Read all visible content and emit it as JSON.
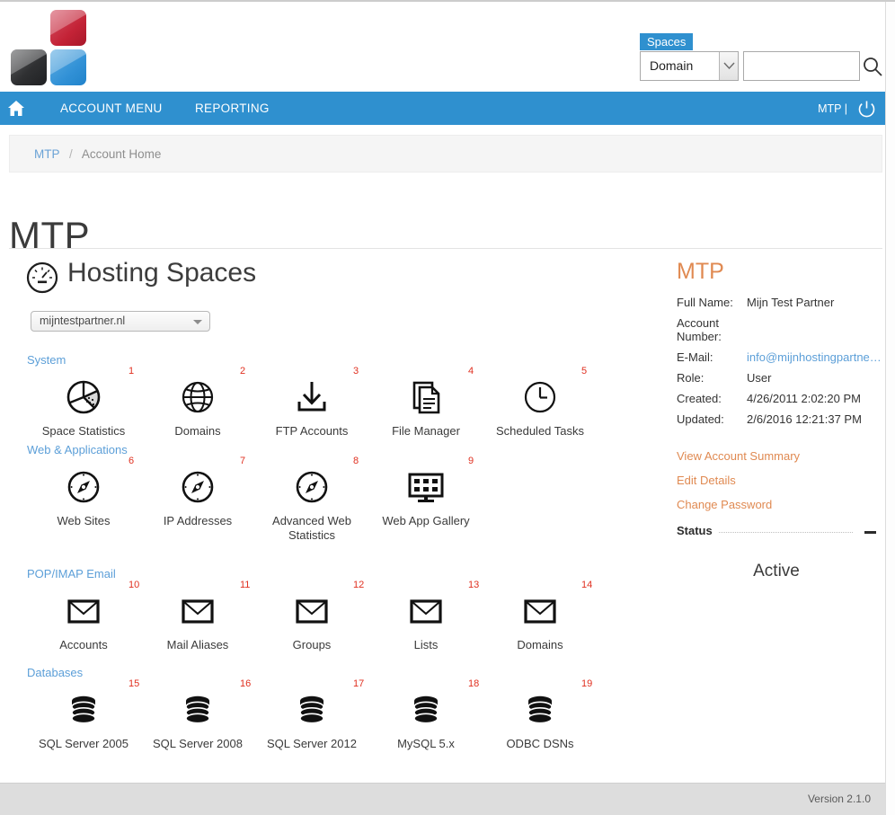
{
  "brand": {
    "logo_name": "mijn-hosting-partner-logo",
    "colors": {
      "accent_blue": "#2f90cf",
      "accent_orange": "#e08a52",
      "badge_red": "#e03020",
      "link_blue": "#5c9fd8"
    }
  },
  "search": {
    "tab_label": "Spaces",
    "scope_value": "Domain",
    "query_value": "",
    "query_placeholder": ""
  },
  "nav": {
    "home_label": "Home",
    "account_menu": "ACCOUNT MENU",
    "reporting": "REPORTING",
    "user": "MTP |",
    "logout_label": "Log off"
  },
  "breadcrumb": {
    "root": "MTP",
    "separator": "/",
    "current": "Account Home"
  },
  "page": {
    "title": "MTP"
  },
  "hosting": {
    "section_title": "Hosting Spaces",
    "space_selected": "mijntestpartner.nl",
    "groups": [
      {
        "label": "System",
        "tiles": [
          {
            "badge": "1",
            "label": "Space Statistics",
            "icon": "pie-chart-icon"
          },
          {
            "badge": "2",
            "label": "Domains",
            "icon": "globe-icon"
          },
          {
            "badge": "3",
            "label": "FTP Accounts",
            "icon": "download-icon"
          },
          {
            "badge": "4",
            "label": "File Manager",
            "icon": "documents-icon"
          },
          {
            "badge": "5",
            "label": "Scheduled Tasks",
            "icon": "clock-icon"
          }
        ]
      },
      {
        "label": "Web & Applications",
        "tiles": [
          {
            "badge": "6",
            "label": "Web Sites",
            "icon": "compass-icon"
          },
          {
            "badge": "7",
            "label": "IP Addresses",
            "icon": "compass-icon"
          },
          {
            "badge": "8",
            "label": "Advanced Web Statistics",
            "icon": "compass-icon"
          },
          {
            "badge": "9",
            "label": "Web App Gallery",
            "icon": "monitor-grid-icon"
          }
        ]
      },
      {
        "label": "POP/IMAP Email",
        "tiles": [
          {
            "badge": "10",
            "label": "Accounts",
            "icon": "envelope-icon"
          },
          {
            "badge": "11",
            "label": "Mail Aliases",
            "icon": "envelope-icon"
          },
          {
            "badge": "12",
            "label": "Groups",
            "icon": "envelope-icon"
          },
          {
            "badge": "13",
            "label": "Lists",
            "icon": "envelope-icon"
          },
          {
            "badge": "14",
            "label": "Domains",
            "icon": "envelope-icon"
          }
        ]
      },
      {
        "label": "Databases",
        "tiles": [
          {
            "badge": "15",
            "label": "SQL Server 2005",
            "icon": "database-icon"
          },
          {
            "badge": "16",
            "label": "SQL Server 2008",
            "icon": "database-icon"
          },
          {
            "badge": "17",
            "label": "SQL Server 2012",
            "icon": "database-icon"
          },
          {
            "badge": "18",
            "label": "MySQL 5.x",
            "icon": "database-icon"
          },
          {
            "badge": "19",
            "label": "ODBC DSNs",
            "icon": "database-icon"
          }
        ]
      }
    ]
  },
  "sidebar": {
    "title": "MTP",
    "info": [
      {
        "key": "Full Name:",
        "value": "Mijn Test Partner",
        "link": false
      },
      {
        "key": "Account Number:",
        "value": "",
        "link": false
      },
      {
        "key": "E-Mail:",
        "value": "info@mijnhostingpartner.n...",
        "link": true
      },
      {
        "key": "Role:",
        "value": "User",
        "link": false
      },
      {
        "key": "Created:",
        "value": "4/26/2011 2:02:20 PM",
        "link": false
      },
      {
        "key": "Updated:",
        "value": "2/6/2016 12:21:37 PM",
        "link": false
      }
    ],
    "links": [
      "View Account Summary",
      "Edit Details",
      "Change Password"
    ],
    "status_header": "Status",
    "status_value": "Active"
  },
  "footer": {
    "version": "Version 2.1.0"
  }
}
